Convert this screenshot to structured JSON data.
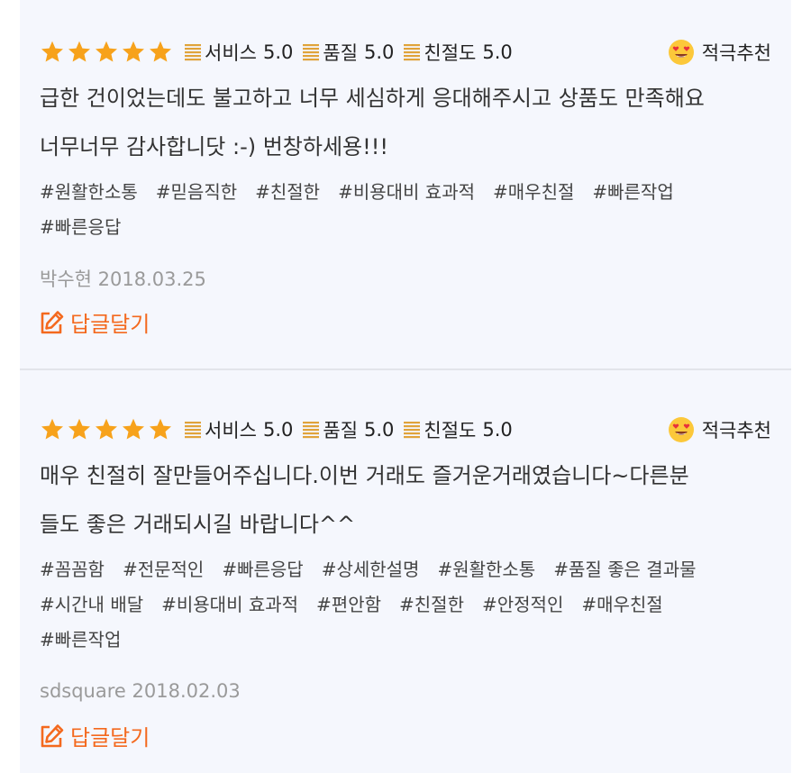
{
  "colors": {
    "star": "#f7a21b",
    "accent": "#f4691e",
    "panel_bg": "#f5f7fd",
    "meta_text": "#9a9a9a"
  },
  "reviews": [
    {
      "stars": 5,
      "scores": [
        {
          "label": "서비스",
          "value": "5.0"
        },
        {
          "label": "품질",
          "value": "5.0"
        },
        {
          "label": "친절도",
          "value": "5.0"
        }
      ],
      "recommend_icon": "heart-eyes-emoji",
      "recommend_label": "적극추천",
      "lines": [
        "급한 건이었는데도 불고하고 너무 세심하게 응대해주시고 상품도 만족해요",
        "너무너무 감사합니닷 :-) 번창하세용!!!"
      ],
      "tags": [
        "#원활한소통",
        "#믿음직한",
        "#친절한",
        "#비용대비 효과적",
        "#매우친절",
        "#빠른작업",
        "#빠른응답"
      ],
      "author": "박수현",
      "date": "2018.03.25",
      "reply_label": "답글달기"
    },
    {
      "stars": 5,
      "scores": [
        {
          "label": "서비스",
          "value": "5.0"
        },
        {
          "label": "품질",
          "value": "5.0"
        },
        {
          "label": "친절도",
          "value": "5.0"
        }
      ],
      "recommend_icon": "heart-eyes-emoji",
      "recommend_label": "적극추천",
      "lines": [
        "매우 친절히 잘만들어주십니다.이번 거래도 즐거운거래였습니다~다른분",
        "들도 좋은 거래되시길 바랍니다^^"
      ],
      "tags": [
        "#꼼꼼함",
        "#전문적인",
        "#빠른응답",
        "#상세한설명",
        "#원활한소통",
        "#품질 좋은 결과물",
        "#시간내 배달",
        "#비용대비 효과적",
        "#편안함",
        "#친절한",
        "#안정적인",
        "#매우친절",
        "#빠른작업"
      ],
      "author": "sdsquare",
      "date": "2018.02.03",
      "reply_label": "답글달기"
    }
  ]
}
